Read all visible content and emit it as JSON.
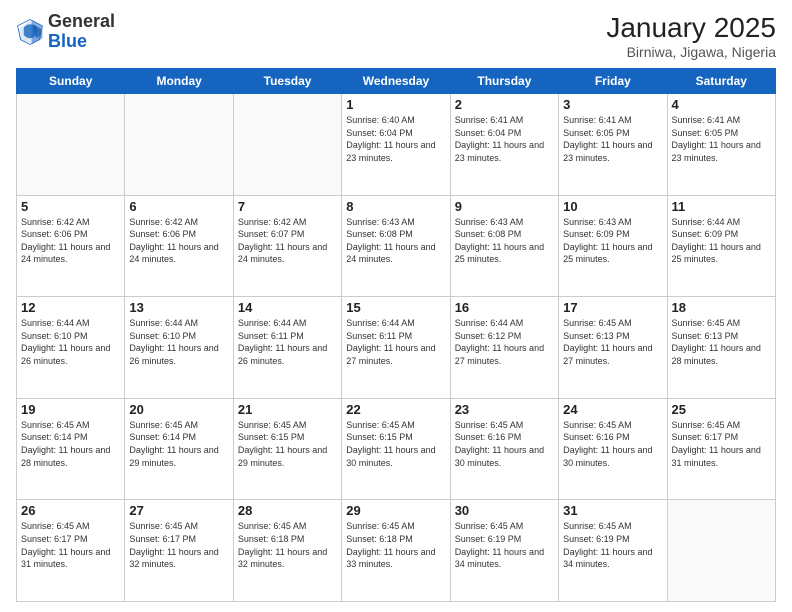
{
  "header": {
    "logo_general": "General",
    "logo_blue": "Blue",
    "month_title": "January 2025",
    "location": "Birniwa, Jigawa, Nigeria"
  },
  "days_of_week": [
    "Sunday",
    "Monday",
    "Tuesday",
    "Wednesday",
    "Thursday",
    "Friday",
    "Saturday"
  ],
  "weeks": [
    [
      {
        "day": "",
        "info": ""
      },
      {
        "day": "",
        "info": ""
      },
      {
        "day": "",
        "info": ""
      },
      {
        "day": "1",
        "info": "Sunrise: 6:40 AM\nSunset: 6:04 PM\nDaylight: 11 hours\nand 23 minutes."
      },
      {
        "day": "2",
        "info": "Sunrise: 6:41 AM\nSunset: 6:04 PM\nDaylight: 11 hours\nand 23 minutes."
      },
      {
        "day": "3",
        "info": "Sunrise: 6:41 AM\nSunset: 6:05 PM\nDaylight: 11 hours\nand 23 minutes."
      },
      {
        "day": "4",
        "info": "Sunrise: 6:41 AM\nSunset: 6:05 PM\nDaylight: 11 hours\nand 23 minutes."
      }
    ],
    [
      {
        "day": "5",
        "info": "Sunrise: 6:42 AM\nSunset: 6:06 PM\nDaylight: 11 hours\nand 24 minutes."
      },
      {
        "day": "6",
        "info": "Sunrise: 6:42 AM\nSunset: 6:06 PM\nDaylight: 11 hours\nand 24 minutes."
      },
      {
        "day": "7",
        "info": "Sunrise: 6:42 AM\nSunset: 6:07 PM\nDaylight: 11 hours\nand 24 minutes."
      },
      {
        "day": "8",
        "info": "Sunrise: 6:43 AM\nSunset: 6:08 PM\nDaylight: 11 hours\nand 24 minutes."
      },
      {
        "day": "9",
        "info": "Sunrise: 6:43 AM\nSunset: 6:08 PM\nDaylight: 11 hours\nand 25 minutes."
      },
      {
        "day": "10",
        "info": "Sunrise: 6:43 AM\nSunset: 6:09 PM\nDaylight: 11 hours\nand 25 minutes."
      },
      {
        "day": "11",
        "info": "Sunrise: 6:44 AM\nSunset: 6:09 PM\nDaylight: 11 hours\nand 25 minutes."
      }
    ],
    [
      {
        "day": "12",
        "info": "Sunrise: 6:44 AM\nSunset: 6:10 PM\nDaylight: 11 hours\nand 26 minutes."
      },
      {
        "day": "13",
        "info": "Sunrise: 6:44 AM\nSunset: 6:10 PM\nDaylight: 11 hours\nand 26 minutes."
      },
      {
        "day": "14",
        "info": "Sunrise: 6:44 AM\nSunset: 6:11 PM\nDaylight: 11 hours\nand 26 minutes."
      },
      {
        "day": "15",
        "info": "Sunrise: 6:44 AM\nSunset: 6:11 PM\nDaylight: 11 hours\nand 27 minutes."
      },
      {
        "day": "16",
        "info": "Sunrise: 6:44 AM\nSunset: 6:12 PM\nDaylight: 11 hours\nand 27 minutes."
      },
      {
        "day": "17",
        "info": "Sunrise: 6:45 AM\nSunset: 6:13 PM\nDaylight: 11 hours\nand 27 minutes."
      },
      {
        "day": "18",
        "info": "Sunrise: 6:45 AM\nSunset: 6:13 PM\nDaylight: 11 hours\nand 28 minutes."
      }
    ],
    [
      {
        "day": "19",
        "info": "Sunrise: 6:45 AM\nSunset: 6:14 PM\nDaylight: 11 hours\nand 28 minutes."
      },
      {
        "day": "20",
        "info": "Sunrise: 6:45 AM\nSunset: 6:14 PM\nDaylight: 11 hours\nand 29 minutes."
      },
      {
        "day": "21",
        "info": "Sunrise: 6:45 AM\nSunset: 6:15 PM\nDaylight: 11 hours\nand 29 minutes."
      },
      {
        "day": "22",
        "info": "Sunrise: 6:45 AM\nSunset: 6:15 PM\nDaylight: 11 hours\nand 30 minutes."
      },
      {
        "day": "23",
        "info": "Sunrise: 6:45 AM\nSunset: 6:16 PM\nDaylight: 11 hours\nand 30 minutes."
      },
      {
        "day": "24",
        "info": "Sunrise: 6:45 AM\nSunset: 6:16 PM\nDaylight: 11 hours\nand 30 minutes."
      },
      {
        "day": "25",
        "info": "Sunrise: 6:45 AM\nSunset: 6:17 PM\nDaylight: 11 hours\nand 31 minutes."
      }
    ],
    [
      {
        "day": "26",
        "info": "Sunrise: 6:45 AM\nSunset: 6:17 PM\nDaylight: 11 hours\nand 31 minutes."
      },
      {
        "day": "27",
        "info": "Sunrise: 6:45 AM\nSunset: 6:17 PM\nDaylight: 11 hours\nand 32 minutes."
      },
      {
        "day": "28",
        "info": "Sunrise: 6:45 AM\nSunset: 6:18 PM\nDaylight: 11 hours\nand 32 minutes."
      },
      {
        "day": "29",
        "info": "Sunrise: 6:45 AM\nSunset: 6:18 PM\nDaylight: 11 hours\nand 33 minutes."
      },
      {
        "day": "30",
        "info": "Sunrise: 6:45 AM\nSunset: 6:19 PM\nDaylight: 11 hours\nand 34 minutes."
      },
      {
        "day": "31",
        "info": "Sunrise: 6:45 AM\nSunset: 6:19 PM\nDaylight: 11 hours\nand 34 minutes."
      },
      {
        "day": "",
        "info": ""
      }
    ]
  ]
}
